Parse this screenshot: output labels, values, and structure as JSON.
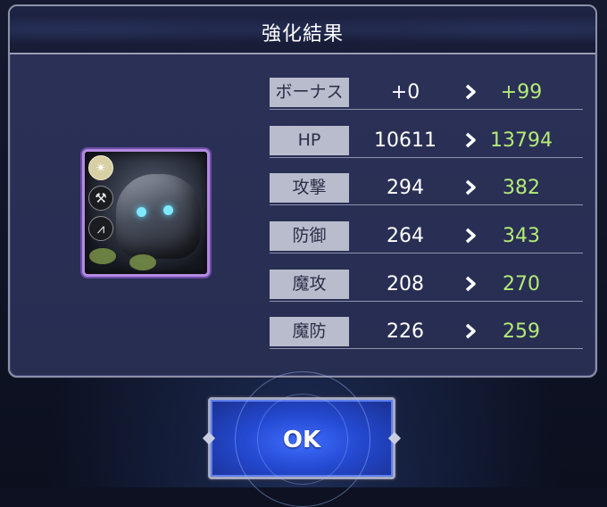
{
  "dialog": {
    "title": "強化結果"
  },
  "portrait": {
    "badges": [
      {
        "icon": "light-element-icon",
        "glyph": "✴"
      },
      {
        "icon": "axe-weapon-icon",
        "glyph": "⚒"
      },
      {
        "icon": "class-wing-icon",
        "glyph": "⩘"
      }
    ]
  },
  "stats": [
    {
      "label": "ボーナス",
      "before": "+0",
      "after": "+99"
    },
    {
      "label": "HP",
      "before": "10611",
      "after": "13794"
    },
    {
      "label": "攻撃",
      "before": "294",
      "after": "382"
    },
    {
      "label": "防御",
      "before": "264",
      "after": "343"
    },
    {
      "label": "魔攻",
      "before": "208",
      "after": "270"
    },
    {
      "label": "魔防",
      "before": "226",
      "after": "259"
    }
  ],
  "ok_button": {
    "label": "OK"
  },
  "colors": {
    "panel": "#2b3157",
    "label_bg": "#b9bccc",
    "increase_text": "#b3ea78",
    "button": "#2449d1"
  }
}
